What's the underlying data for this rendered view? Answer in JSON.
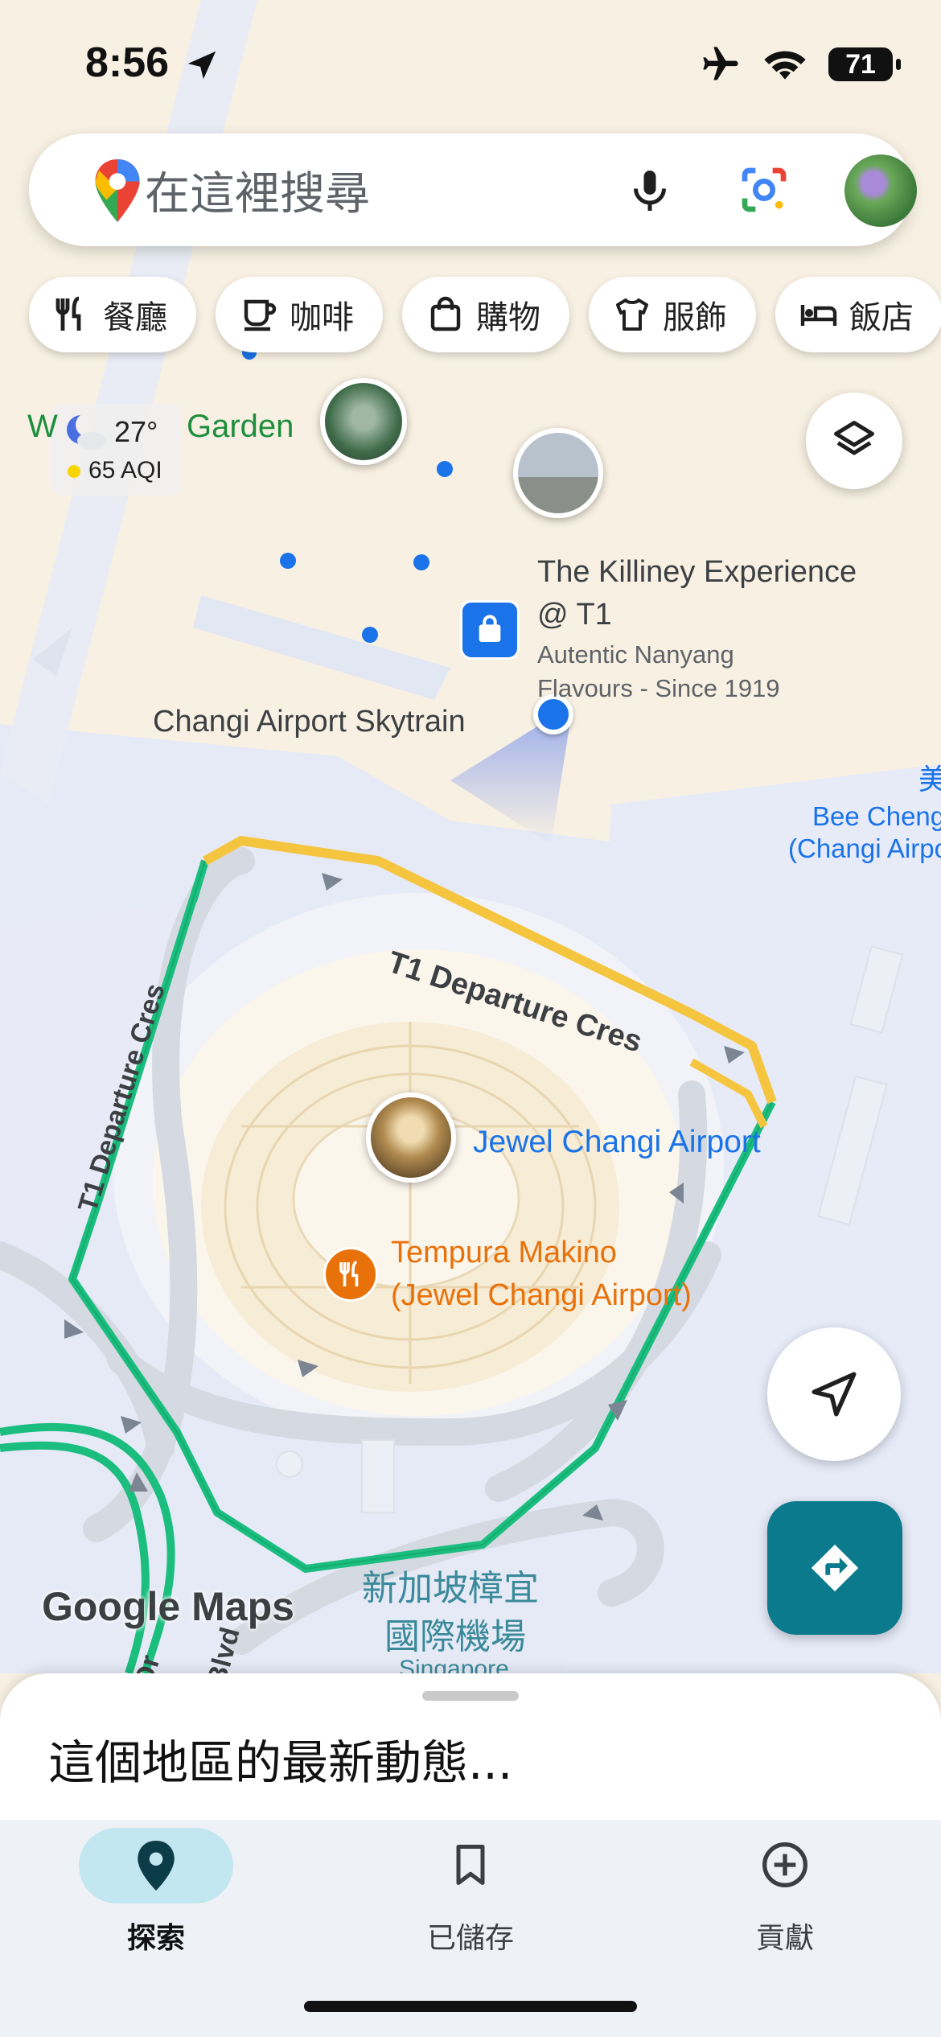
{
  "status_bar": {
    "time": "8:56",
    "battery": "71"
  },
  "search": {
    "placeholder": "在這裡搜尋"
  },
  "chips": [
    {
      "label": "餐廳",
      "icon": "restaurant-icon"
    },
    {
      "label": "咖啡",
      "icon": "coffee-icon"
    },
    {
      "label": "購物",
      "icon": "shopping-bag-icon"
    },
    {
      "label": "服飾",
      "icon": "shirt-icon"
    },
    {
      "label": "飯店",
      "icon": "hotel-bed-icon"
    }
  ],
  "weather": {
    "temp": "27°",
    "aqi": "65 AQI"
  },
  "map_labels": {
    "garden_w": "W",
    "garden": "Garden",
    "killiney_title_1": "The Killiney Experience",
    "killiney_title_2": "@ T1",
    "killiney_sub_1": "Autentic Nanyang",
    "killiney_sub_2": "Flavours - Since 1919",
    "skytrain": "Changi Airport Skytrain",
    "bee_cheng_cjk": "美",
    "bee_cheng_1": "Bee Cheng",
    "bee_cheng_2": "(Changi Airpo",
    "road_top": "T1 Departure Cres",
    "road_left": "T1 Departure Cres",
    "jewel": "Jewel Changi Airport",
    "tempura_1": "Tempura Makino",
    "tempura_2": "(Jewel Changi Airport)",
    "airport_zh_1": "新加坡樟宜",
    "airport_zh_2": "國際機場",
    "airport_en": "Singapore",
    "road_dr": "Dr",
    "road_blvd": "Blvd",
    "google_maps": "Google Maps"
  },
  "sheet": {
    "title": "這個地區的最新動態..."
  },
  "nav": [
    {
      "label": "探索",
      "icon": "explore-pin-icon",
      "active": true
    },
    {
      "label": "已儲存",
      "icon": "bookmark-icon",
      "active": false
    },
    {
      "label": "貢獻",
      "icon": "add-circle-icon",
      "active": false
    }
  ],
  "colors": {
    "route_green": "#1bbe7e",
    "road_yellow": "#f6c540",
    "accent_blue": "#1a73e8",
    "directions_teal": "#0a7a8c",
    "poi_orange": "#e8710a",
    "nav_active_pill": "#c2e7f0"
  }
}
